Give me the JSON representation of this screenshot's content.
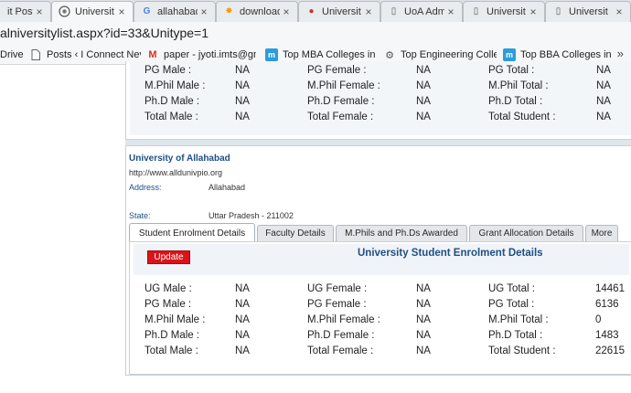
{
  "tabs": [
    {
      "label": "it Post",
      "icon": "",
      "icon_color": "#d35400"
    },
    {
      "label": "Universit",
      "icon": "seal",
      "icon_color": "#555555"
    },
    {
      "label": "allahabad",
      "icon": "G",
      "icon_color": "#4285f4"
    },
    {
      "label": "download",
      "icon": "✸",
      "icon_color": "#f39c12"
    },
    {
      "label": "Universit",
      "icon": "●",
      "icon_color": "#c0392b"
    },
    {
      "label": "UoA Adm",
      "icon": "▯",
      "icon_color": "#555555"
    },
    {
      "label": "Universit",
      "icon": "▯",
      "icon_color": "#555555"
    },
    {
      "label": "Universit",
      "icon": "▯",
      "icon_color": "#555555"
    }
  ],
  "tab_close": "×",
  "address": "alniversitylist.aspx?id=33&Unitype=1",
  "bookmarks": [
    {
      "label": "Drive",
      "icon": ""
    },
    {
      "label": "Posts ‹ I Connect Nev",
      "icon": "▯"
    },
    {
      "label": "paper - jyoti.imts@gm",
      "icon": "M"
    },
    {
      "label": "Top MBA Colleges in",
      "icon": "m"
    },
    {
      "label": "Top Engineering Colle",
      "icon": "⚙"
    },
    {
      "label": "Top BBA Colleges in I",
      "icon": "m"
    }
  ],
  "bookmarks_more": "»",
  "top_stats": [
    [
      "PG Male :",
      "NA",
      "PG Female :",
      "NA",
      "PG Total :",
      "NA"
    ],
    [
      "M.Phil Male :",
      "NA",
      "M.Phil Female :",
      "NA",
      "M.Phil Total :",
      "NA"
    ],
    [
      "Ph.D Male :",
      "NA",
      "Ph.D Female :",
      "NA",
      "Ph.D Total :",
      "NA"
    ],
    [
      "Total Male :",
      "NA",
      "Total Female :",
      "NA",
      "Total Student :",
      "NA"
    ]
  ],
  "university": {
    "name": "University of Allahabad",
    "url": "http://www.alldunivpio.org",
    "address_label": "Address:",
    "address_value": "Allahabad",
    "state_label": "State:",
    "state_value": "Uttar Pradesh - 211002"
  },
  "inner_tabs": [
    "Student Enrolment Details",
    "Faculty Details",
    "M.Phils and Ph.Ds Awarded",
    "Grant Allocation Details",
    "More"
  ],
  "enrolment": {
    "update_label": "Update",
    "title": "University Student Enrolment Details",
    "stats": [
      [
        "UG Male :",
        "NA",
        "UG Female :",
        "NA",
        "UG Total :",
        "14461"
      ],
      [
        "PG Male :",
        "NA",
        "PG Female :",
        "NA",
        "PG Total :",
        "6136"
      ],
      [
        "M.Phil Male :",
        "NA",
        "M.Phil Female :",
        "NA",
        "M.Phil Total :",
        "0"
      ],
      [
        "Ph.D Male :",
        "NA",
        "Ph.D Female :",
        "NA",
        "Ph.D Total :",
        "1483"
      ],
      [
        "Total Male :",
        "NA",
        "Total Female :",
        "NA",
        "Total Student :",
        "22615"
      ]
    ]
  }
}
